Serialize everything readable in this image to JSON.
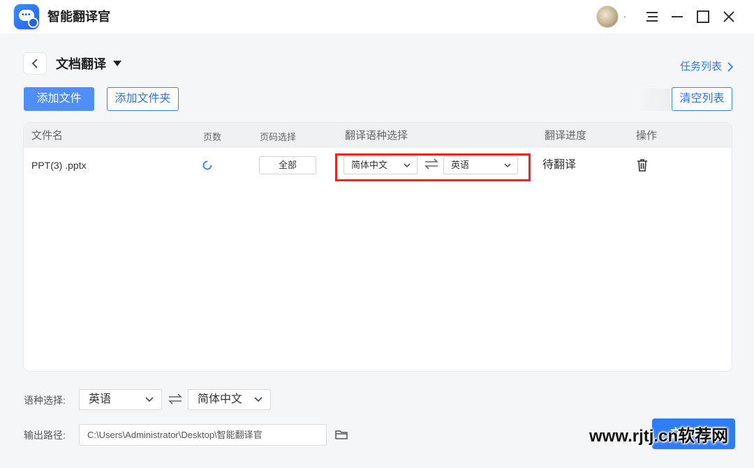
{
  "app": {
    "title": "智能翻译官",
    "user_suffix": "."
  },
  "header": {
    "page_title": "文档翻译",
    "task_list_link": "任务列表"
  },
  "toolbar": {
    "add_file": "添加文件",
    "add_folder": "添加文件夹",
    "clear_list": "清空列表"
  },
  "table": {
    "columns": [
      "文件名",
      "页数",
      "页码选择",
      "翻译语种选择",
      "翻译进度",
      "操作"
    ],
    "rows": [
      {
        "filename": "PPT(3) .pptx",
        "page_selection": "全部",
        "source_lang": "简体中文",
        "target_lang": "英语",
        "progress": "待翻译"
      }
    ]
  },
  "settings": {
    "lang_label": "语种选择:",
    "source_lang": "英语",
    "target_lang": "简体中文",
    "output_label": "输出路径:",
    "output_path": "C:\\Users\\Administrator\\Desktop\\智能翻译官"
  },
  "actions": {
    "start_button": "立即翻译"
  },
  "watermark": "www.rjtj.cn软荐网",
  "colors": {
    "accent": "#2f7df5",
    "highlight": "#e8271c"
  }
}
